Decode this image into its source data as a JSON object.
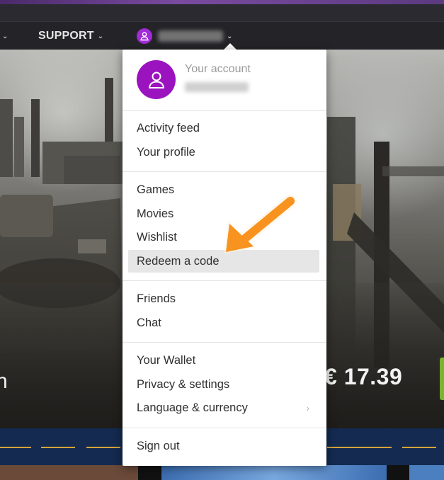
{
  "nav": {
    "support_label": "SUPPORT",
    "chevron": "⌄"
  },
  "account": {
    "title": "Your account"
  },
  "menu": {
    "section1": [
      {
        "label": "Activity feed"
      },
      {
        "label": "Your profile"
      }
    ],
    "section2": [
      {
        "label": "Games"
      },
      {
        "label": "Movies"
      },
      {
        "label": "Wishlist"
      },
      {
        "label": "Redeem a code",
        "highlighted": true
      }
    ],
    "section3": [
      {
        "label": "Friends"
      },
      {
        "label": "Chat"
      }
    ],
    "section4": [
      {
        "label": "Your Wallet"
      },
      {
        "label": "Privacy & settings"
      },
      {
        "label": "Language & currency",
        "has_submenu": true
      }
    ],
    "section5": [
      {
        "label": "Sign out"
      }
    ]
  },
  "hero": {
    "price": "€ 17.39"
  },
  "colors": {
    "avatar": "#9b13bf",
    "arrow": "#f7931e",
    "band": "#142a50",
    "dash": "#d6a43a",
    "accent_green": "#7ab531"
  },
  "icons": {
    "user": "user-icon",
    "chevron": "chevron-down-icon",
    "submenu": "chevron-right-icon",
    "annotation": "arrow-icon"
  }
}
